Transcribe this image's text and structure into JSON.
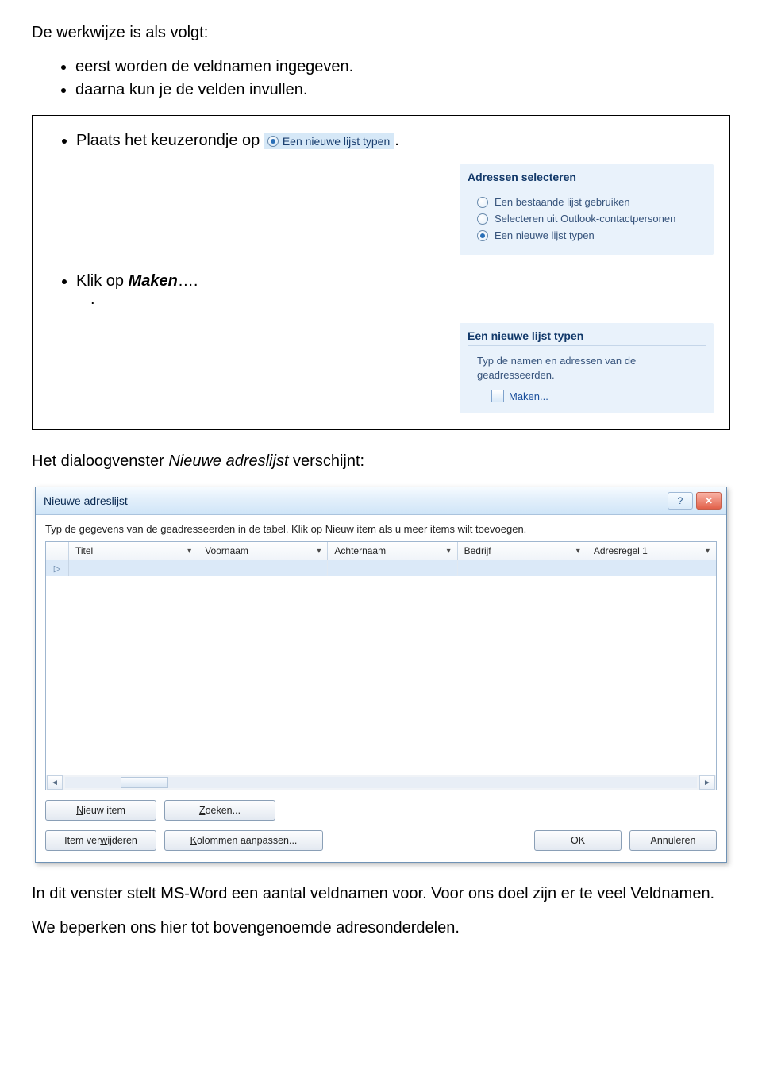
{
  "intro": "De werkwijze is als volgt:",
  "intro_bullets": [
    "eerst worden de veldnamen ingegeven.",
    "daarna kun je de velden invullen."
  ],
  "step_radio": {
    "prefix": "Plaats  het keuzerondje op ",
    "chip_label": "Een nieuwe lijst typen",
    "suffix": "."
  },
  "wizard_select": {
    "title": "Adressen selecteren",
    "options": [
      {
        "label": "Een bestaande lijst gebruiken",
        "selected": false
      },
      {
        "label": "Selecteren uit Outlook-contactpersonen",
        "selected": false
      },
      {
        "label": "Een nieuwe lijst typen",
        "selected": true
      }
    ]
  },
  "step_maken": {
    "prefix": "Klik op ",
    "action": "Maken",
    "suffix": "….",
    "trail_dot": "."
  },
  "wizard_type": {
    "title": "Een nieuwe lijst typen",
    "body1": "Typ de namen en adressen van de",
    "body2": "geadresseerden.",
    "link": "Maken..."
  },
  "after_frame": {
    "p1_a": "Het dialoogvenster ",
    "p1_i": "Nieuwe adreslijst",
    "p1_b": " verschijnt:"
  },
  "dialog": {
    "title": "Nieuwe adreslijst",
    "help_glyph": "?",
    "close_glyph": "✕",
    "instruction": "Typ de gegevens van de geadresseerden in de tabel. Klik op Nieuw item als u meer items wilt toevoegen.",
    "columns": [
      "Titel",
      "Voornaam",
      "Achternaam",
      "Bedrijf",
      "Adresregel 1"
    ],
    "row_marker_glyph": "▷",
    "scroll": {
      "left": "◄",
      "right": "►"
    },
    "buttons": {
      "nieuw_item": {
        "pre": "",
        "u": "N",
        "post": "ieuw item"
      },
      "zoeken": {
        "pre": "",
        "u": "Z",
        "post": "oeken..."
      },
      "verwijderen": {
        "pre": "Item ver",
        "u": "w",
        "post": "ijderen"
      },
      "kolommen": {
        "pre": "",
        "u": "K",
        "post": "olommen aanpassen..."
      },
      "ok": {
        "pre": "OK",
        "u": "",
        "post": ""
      },
      "annuleren": {
        "pre": "Annuleren",
        "u": "",
        "post": ""
      }
    }
  },
  "closing": {
    "p1": "In dit venster stelt MS-Word een aantal veldnamen voor.  Voor ons doel zijn er te veel Veldnamen.",
    "p2": "We beperken ons hier tot bovengenoemde adresonderdelen."
  }
}
